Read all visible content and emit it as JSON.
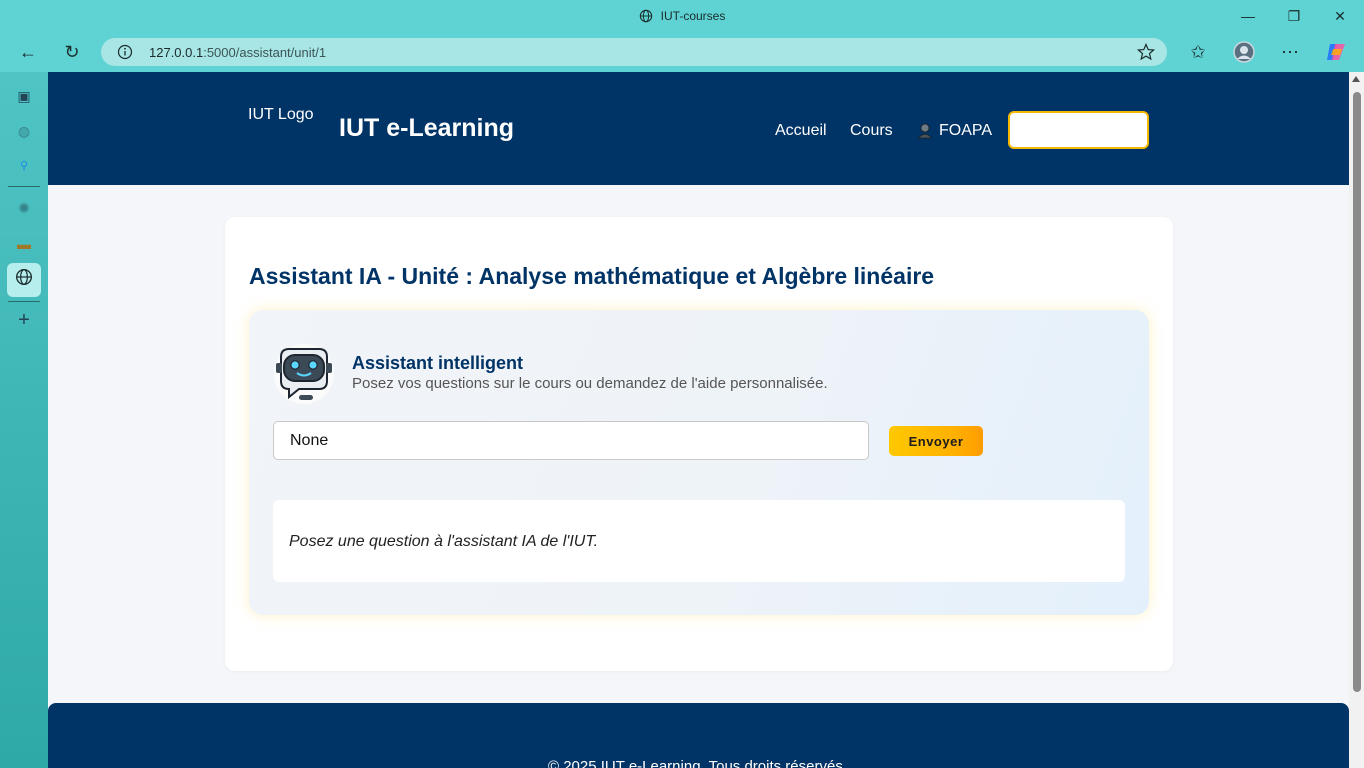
{
  "browser": {
    "tab_title": "IUT-courses",
    "url_host": "127.0.0.1",
    "url_rest": ":5000/assistant/unit/1",
    "window_controls": [
      "minimize-icon",
      "restore-icon",
      "close-icon"
    ],
    "toolbar_icons": [
      "back-arrow-icon",
      "reload-icon",
      "info-icon",
      "star-icon",
      "favorites-icon",
      "profile-avatar",
      "more-icon",
      "copilot-icon"
    ],
    "theme_color": "#5fd3d3"
  },
  "sidebar": {
    "items": [
      "tab-actions-icon",
      "globe-icon",
      "search-icon",
      "chatgpt-icon",
      "notebook-icon",
      "globe-icon-active",
      "add-icon"
    ]
  },
  "header": {
    "logo_alt": "IUT Logo",
    "brand": "IUT e-Learning",
    "nav": {
      "home": "Accueil",
      "courses": "Cours",
      "user": "FOAPA"
    },
    "background": "#003366",
    "accent": "#f5b800"
  },
  "main": {
    "title": "Assistant IA - Unité : Analyse mathématique et Algèbre linéaire",
    "assistant": {
      "name": "Assistant intelligent",
      "subtitle": "Posez vos questions sur le cours ou demandez de l'aide personnalisée.",
      "input_value": "None",
      "send_label": "Envoyer",
      "response": "Posez une question à l'assistant IA de l'IUT."
    }
  },
  "footer": {
    "text": "© 2025 IUT e-Learning. Tous droits réservés."
  }
}
